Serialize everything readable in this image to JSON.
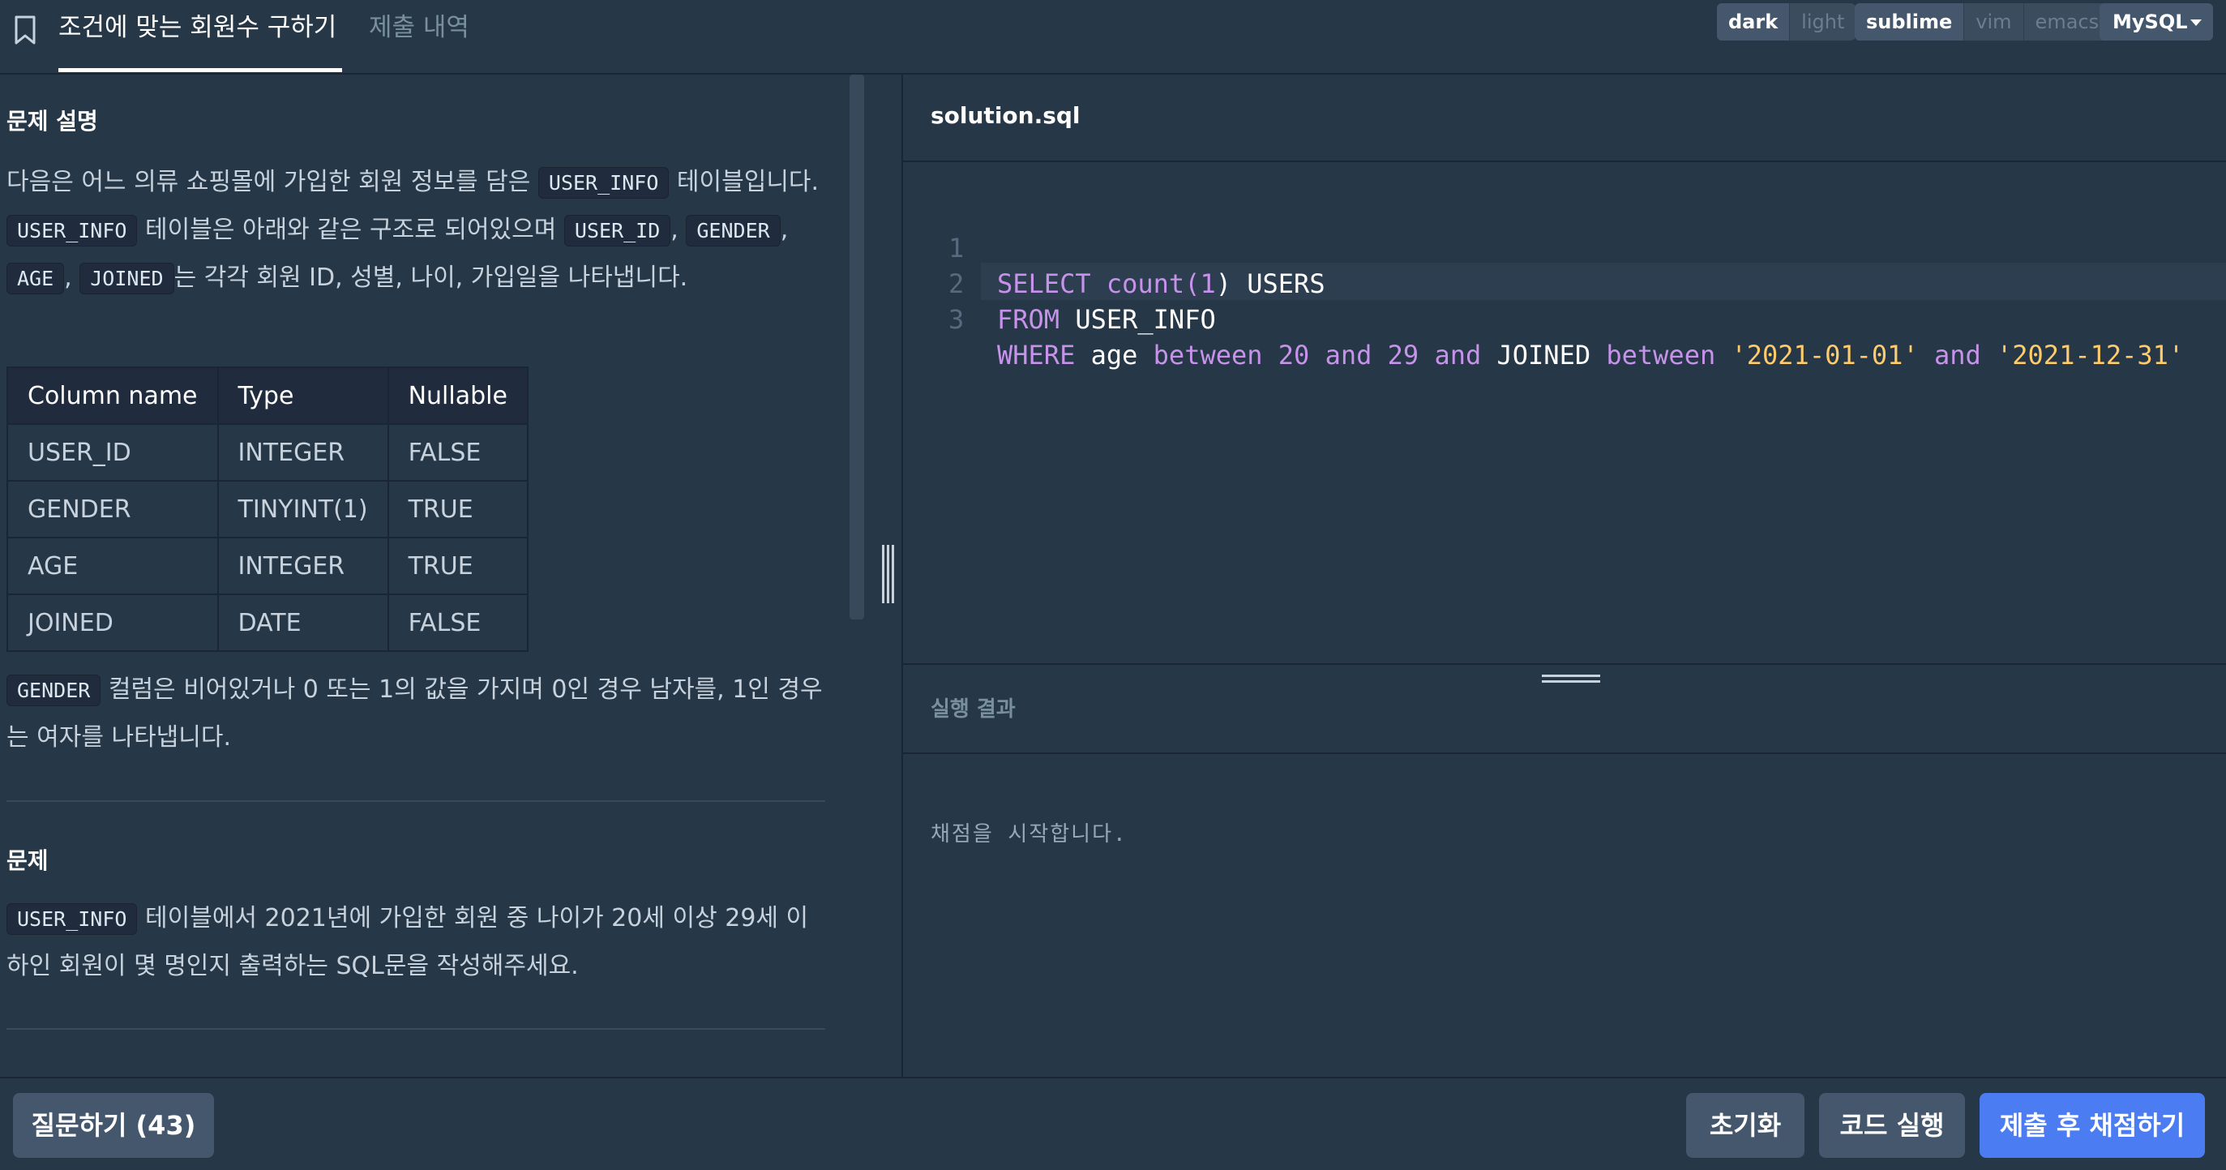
{
  "header": {
    "problem_title": "조건에 맞는 회원수 구하기",
    "submission_history": "제출 내역",
    "theme_options": [
      "dark",
      "light"
    ],
    "theme_selected": "dark",
    "keymap_options": [
      "sublime",
      "vim",
      "emacs"
    ],
    "keymap_selected": "sublime",
    "language": "MySQL"
  },
  "problem": {
    "description_heading": "문제 설명",
    "intro_1": "다음은 어느 의류 쇼핑몰에 가입한 회원 정보를 담은",
    "intro_table": "USER_INFO",
    "intro_2": "테이블입니다.",
    "intro_table_2": "USER_INFO",
    "intro_3": "테이블은 아래와 같은 구조로 되어있으며",
    "col_user_id": "USER_ID",
    "comma": ",",
    "col_gender": "GENDER",
    "col_age": "AGE",
    "col_joined": "JOINED",
    "intro_4": "는 각각 회원 ID, 성별, 나이, 가입일을 나타냅니다.",
    "schema": {
      "headers": [
        "Column name",
        "Type",
        "Nullable"
      ],
      "rows": [
        [
          "USER_ID",
          "INTEGER",
          "FALSE"
        ],
        [
          "GENDER",
          "TINYINT(1)",
          "TRUE"
        ],
        [
          "AGE",
          "INTEGER",
          "TRUE"
        ],
        [
          "JOINED",
          "DATE",
          "FALSE"
        ]
      ]
    },
    "gender_code": "GENDER",
    "gender_note": "컬럼은 비어있거나 0 또는 1의 값을 가지며 0인 경우 남자를, 1인 경우는 여자를 나타냅니다.",
    "question_heading": "문제",
    "question_table": "USER_INFO",
    "question_text": "테이블에서 2021년에 가입한 회원 중 나이가 20세 이상 29세 이하인 회원이 몇 명인지 출력하는 SQL문을 작성해주세요."
  },
  "editor": {
    "filename": "solution.sql",
    "line_numbers": [
      "1",
      "2",
      "3"
    ],
    "tokens": {
      "l1_select": "SELECT",
      "l1_count": "count(",
      "l1_one": "1",
      "l1_close": ") USERS",
      "l2_from": "FROM",
      "l2_table": " USER_INFO",
      "l3_where": "WHERE",
      "l3_age": " age ",
      "l3_between": "between",
      "l3_20": "20",
      "l3_and": "and",
      "l3_29": "29",
      "l3_and2": "and",
      "l3_joined": " JOINED ",
      "l3_between2": "between",
      "l3_d1": "'2021-01-01'",
      "l3_and3": "and",
      "l3_d2": "'2021-12-31'"
    }
  },
  "result": {
    "title": "실행 결과",
    "message": "채점을 시작합니다."
  },
  "footer": {
    "ask_label": "질문하기 (43)",
    "reset_label": "초기화",
    "run_label": "코드 실행",
    "submit_label": "제출 후 채점하기"
  },
  "colors": {
    "background": "#263747",
    "submit_button": "#4c7cf2",
    "keyword": "#c792ea",
    "string": "#ffcb6b"
  }
}
